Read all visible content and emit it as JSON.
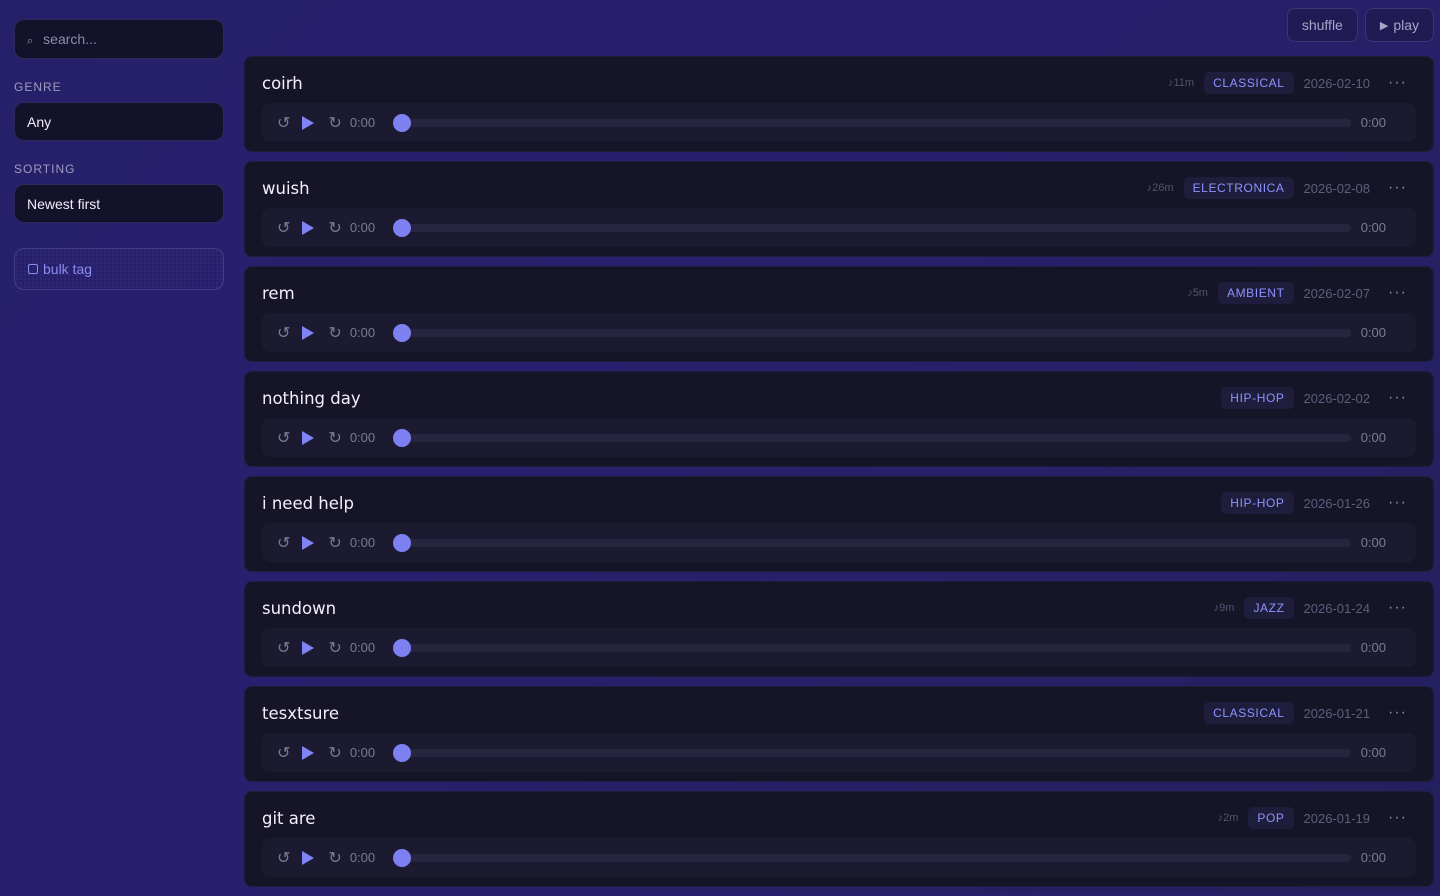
{
  "search": {
    "placeholder": "search...",
    "icon": "search-icon"
  },
  "genre": {
    "label": "GENRE",
    "value": "Any"
  },
  "sorting": {
    "label": "SORTING",
    "value": "Newest first"
  },
  "bulk_tag": {
    "label": "bulk tag"
  },
  "topbar": {
    "shuffle_label": "shuffle",
    "play_label": "play"
  },
  "colors": {
    "accent": "#7d80f0",
    "genre_text": "#8f93ff",
    "card_bg": "#161528"
  },
  "tracks": [
    {
      "title": "coirh",
      "duration": "♪11m",
      "genre": "CLASSICAL",
      "date": "2026-02-10",
      "current_time": "0:00",
      "total_time": "0:00",
      "progress": 0
    },
    {
      "title": "wuish",
      "duration": "♪26m",
      "genre": "ELECTRONICA",
      "date": "2026-02-08",
      "current_time": "0:00",
      "total_time": "0:00",
      "progress": 0
    },
    {
      "title": "rem",
      "duration": "♪5m",
      "genre": "AMBIENT",
      "date": "2026-02-07",
      "current_time": "0:00",
      "total_time": "0:00",
      "progress": 0
    },
    {
      "title": "nothing day",
      "duration": "",
      "genre": "HIP-HOP",
      "date": "2026-02-02",
      "current_time": "0:00",
      "total_time": "0:00",
      "progress": 0
    },
    {
      "title": "i need help",
      "duration": "",
      "genre": "HIP-HOP",
      "date": "2026-01-26",
      "current_time": "0:00",
      "total_time": "0:00",
      "progress": 0
    },
    {
      "title": "sundown",
      "duration": "♪9m",
      "genre": "JAZZ",
      "date": "2026-01-24",
      "current_time": "0:00",
      "total_time": "0:00",
      "progress": 0
    },
    {
      "title": "tesxtsure",
      "duration": "",
      "genre": "CLASSICAL",
      "date": "2026-01-21",
      "current_time": "0:00",
      "total_time": "0:00",
      "progress": 0
    },
    {
      "title": "git are",
      "duration": "♪2m",
      "genre": "POP",
      "date": "2026-01-19",
      "current_time": "0:00",
      "total_time": "0:00",
      "progress": 0
    }
  ]
}
